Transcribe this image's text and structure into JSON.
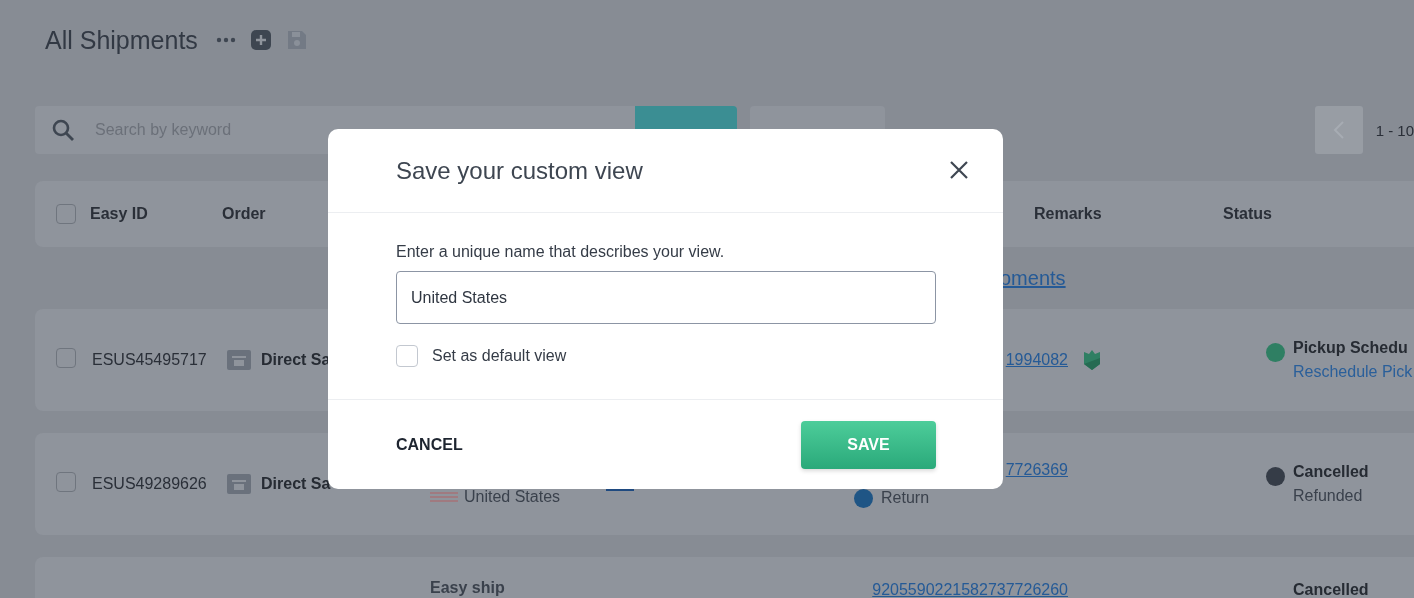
{
  "page": {
    "title": "All Shipments"
  },
  "search": {
    "placeholder": "Search by keyword"
  },
  "pagination": {
    "range": "1 - 10"
  },
  "table": {
    "columns": [
      "Easy ID",
      "Order",
      "Remarks",
      "Status"
    ],
    "all_checked": false,
    "link": "oments",
    "rows": [
      {
        "checked": false,
        "easy_id": "ESUS45495717",
        "order": "Direct Sa",
        "tracking": "1994082",
        "shield": true,
        "status": {
          "label": "Pickup Schedu",
          "color": "#2f7f63",
          "sub": {
            "kind": "link",
            "text": "Reschedule Pick"
          }
        }
      },
      {
        "checked": false,
        "easy_id": "ESUS49289626",
        "order": "Direct Sa",
        "destination": "United States",
        "tracking": "7726369",
        "shield": false,
        "tag": {
          "label": "Return",
          "color": "#1f5585"
        },
        "status": {
          "label": "Cancelled",
          "color": "#353c47",
          "sub": {
            "kind": "text",
            "text": "Refunded"
          }
        }
      },
      {
        "destination": "Easy ship",
        "tracking": "9205590221582737726260",
        "shield": false,
        "status": {
          "label": "Cancelled"
        }
      }
    ]
  },
  "dialog": {
    "title": "Save your custom view",
    "label": "Enter a unique name that describes your view.",
    "value": "United States",
    "default_checkbox": {
      "label": "Set as default view",
      "checked": false
    },
    "buttons": {
      "cancel": "CANCEL",
      "save": "SAVE"
    }
  }
}
